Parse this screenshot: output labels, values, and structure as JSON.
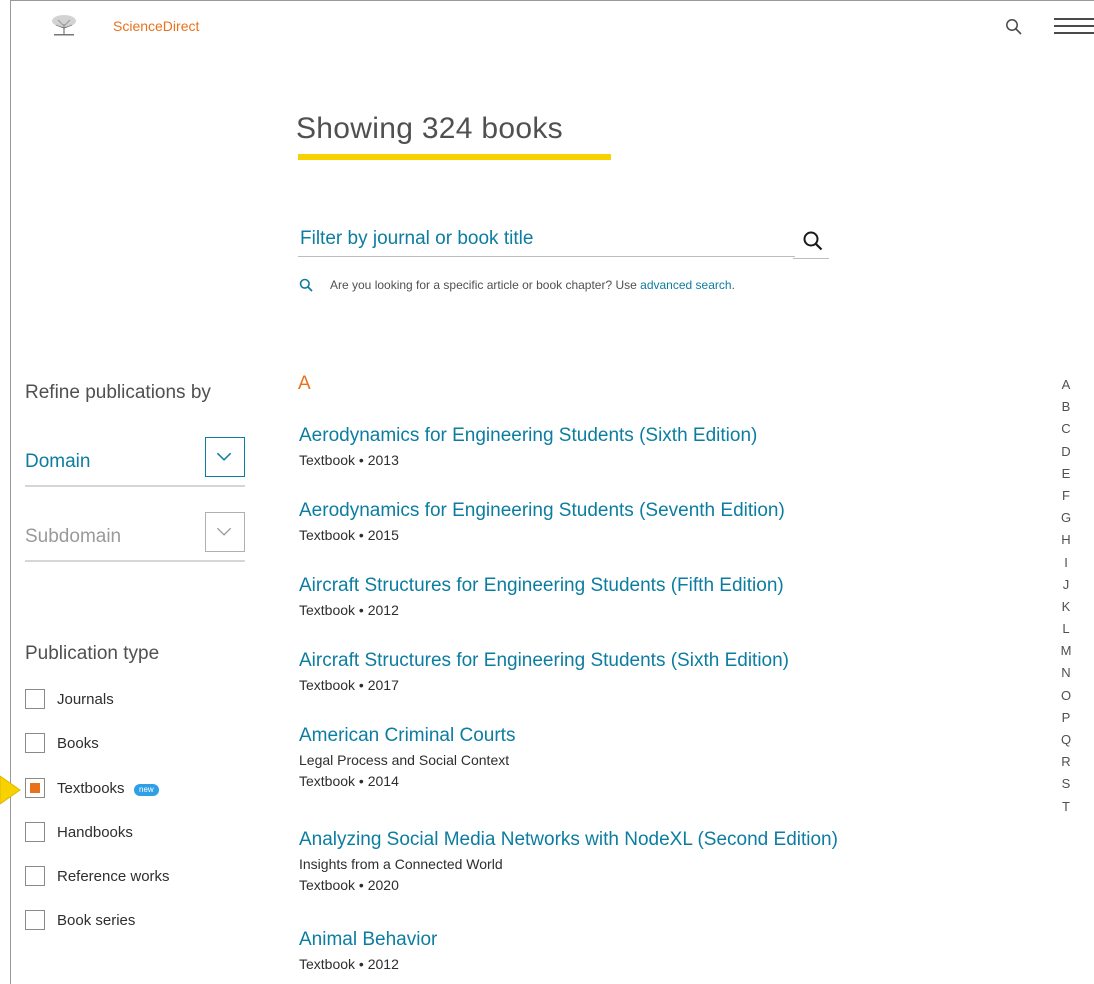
{
  "header": {
    "brand": "ScienceDirect",
    "icons": {
      "logo": "elsevier-tree-logo",
      "search": "search-icon",
      "menu": "hamburger-menu-icon"
    }
  },
  "main": {
    "title": "Showing 324 books",
    "filter": {
      "placeholder": "Filter by journal or book title"
    },
    "hint": {
      "text": "Are you looking for a specific article or book chapter? Use ",
      "link": "advanced search",
      "suffix": "."
    }
  },
  "sidebar": {
    "refine_title": "Refine publications by",
    "domain_label": "Domain",
    "subdomain_label": "Subdomain",
    "pubtype_title": "Publication type",
    "types": [
      {
        "label": "Journals",
        "checked": false
      },
      {
        "label": "Books",
        "checked": false
      },
      {
        "label": "Textbooks",
        "checked": true,
        "badge": "new"
      },
      {
        "label": "Handbooks",
        "checked": false
      },
      {
        "label": "Reference works",
        "checked": false
      },
      {
        "label": "Book series",
        "checked": false
      }
    ]
  },
  "list": {
    "letter": "A",
    "books": [
      {
        "title": "Aerodynamics for Engineering Students (Sixth Edition)",
        "subtitle": "",
        "meta": "Textbook • 2013"
      },
      {
        "title": "Aerodynamics for Engineering Students (Seventh Edition)",
        "subtitle": "",
        "meta": "Textbook • 2015"
      },
      {
        "title": "Aircraft Structures for Engineering Students (Fifth Edition)",
        "subtitle": "",
        "meta": "Textbook • 2012"
      },
      {
        "title": "Aircraft Structures for Engineering Students (Sixth Edition)",
        "subtitle": "",
        "meta": "Textbook • 2017"
      },
      {
        "title": "American Criminal Courts",
        "subtitle": "Legal Process and Social Context",
        "meta": "Textbook • 2014"
      },
      {
        "title": "Analyzing Social Media Networks with NodeXL (Second Edition)",
        "subtitle": "Insights from a Connected World",
        "meta": "Textbook • 2020"
      },
      {
        "title": "Animal Behavior",
        "subtitle": "",
        "meta": "Textbook • 2012"
      }
    ]
  },
  "alphabet": [
    "A",
    "B",
    "C",
    "D",
    "E",
    "F",
    "G",
    "H",
    "I",
    "J",
    "K",
    "L",
    "M",
    "N",
    "O",
    "P",
    "Q",
    "R",
    "S",
    "T"
  ],
  "colors": {
    "accent": "#e9711c",
    "link": "#0c7da1",
    "underline": "#f7d100",
    "badge": "#2fa0e6"
  }
}
